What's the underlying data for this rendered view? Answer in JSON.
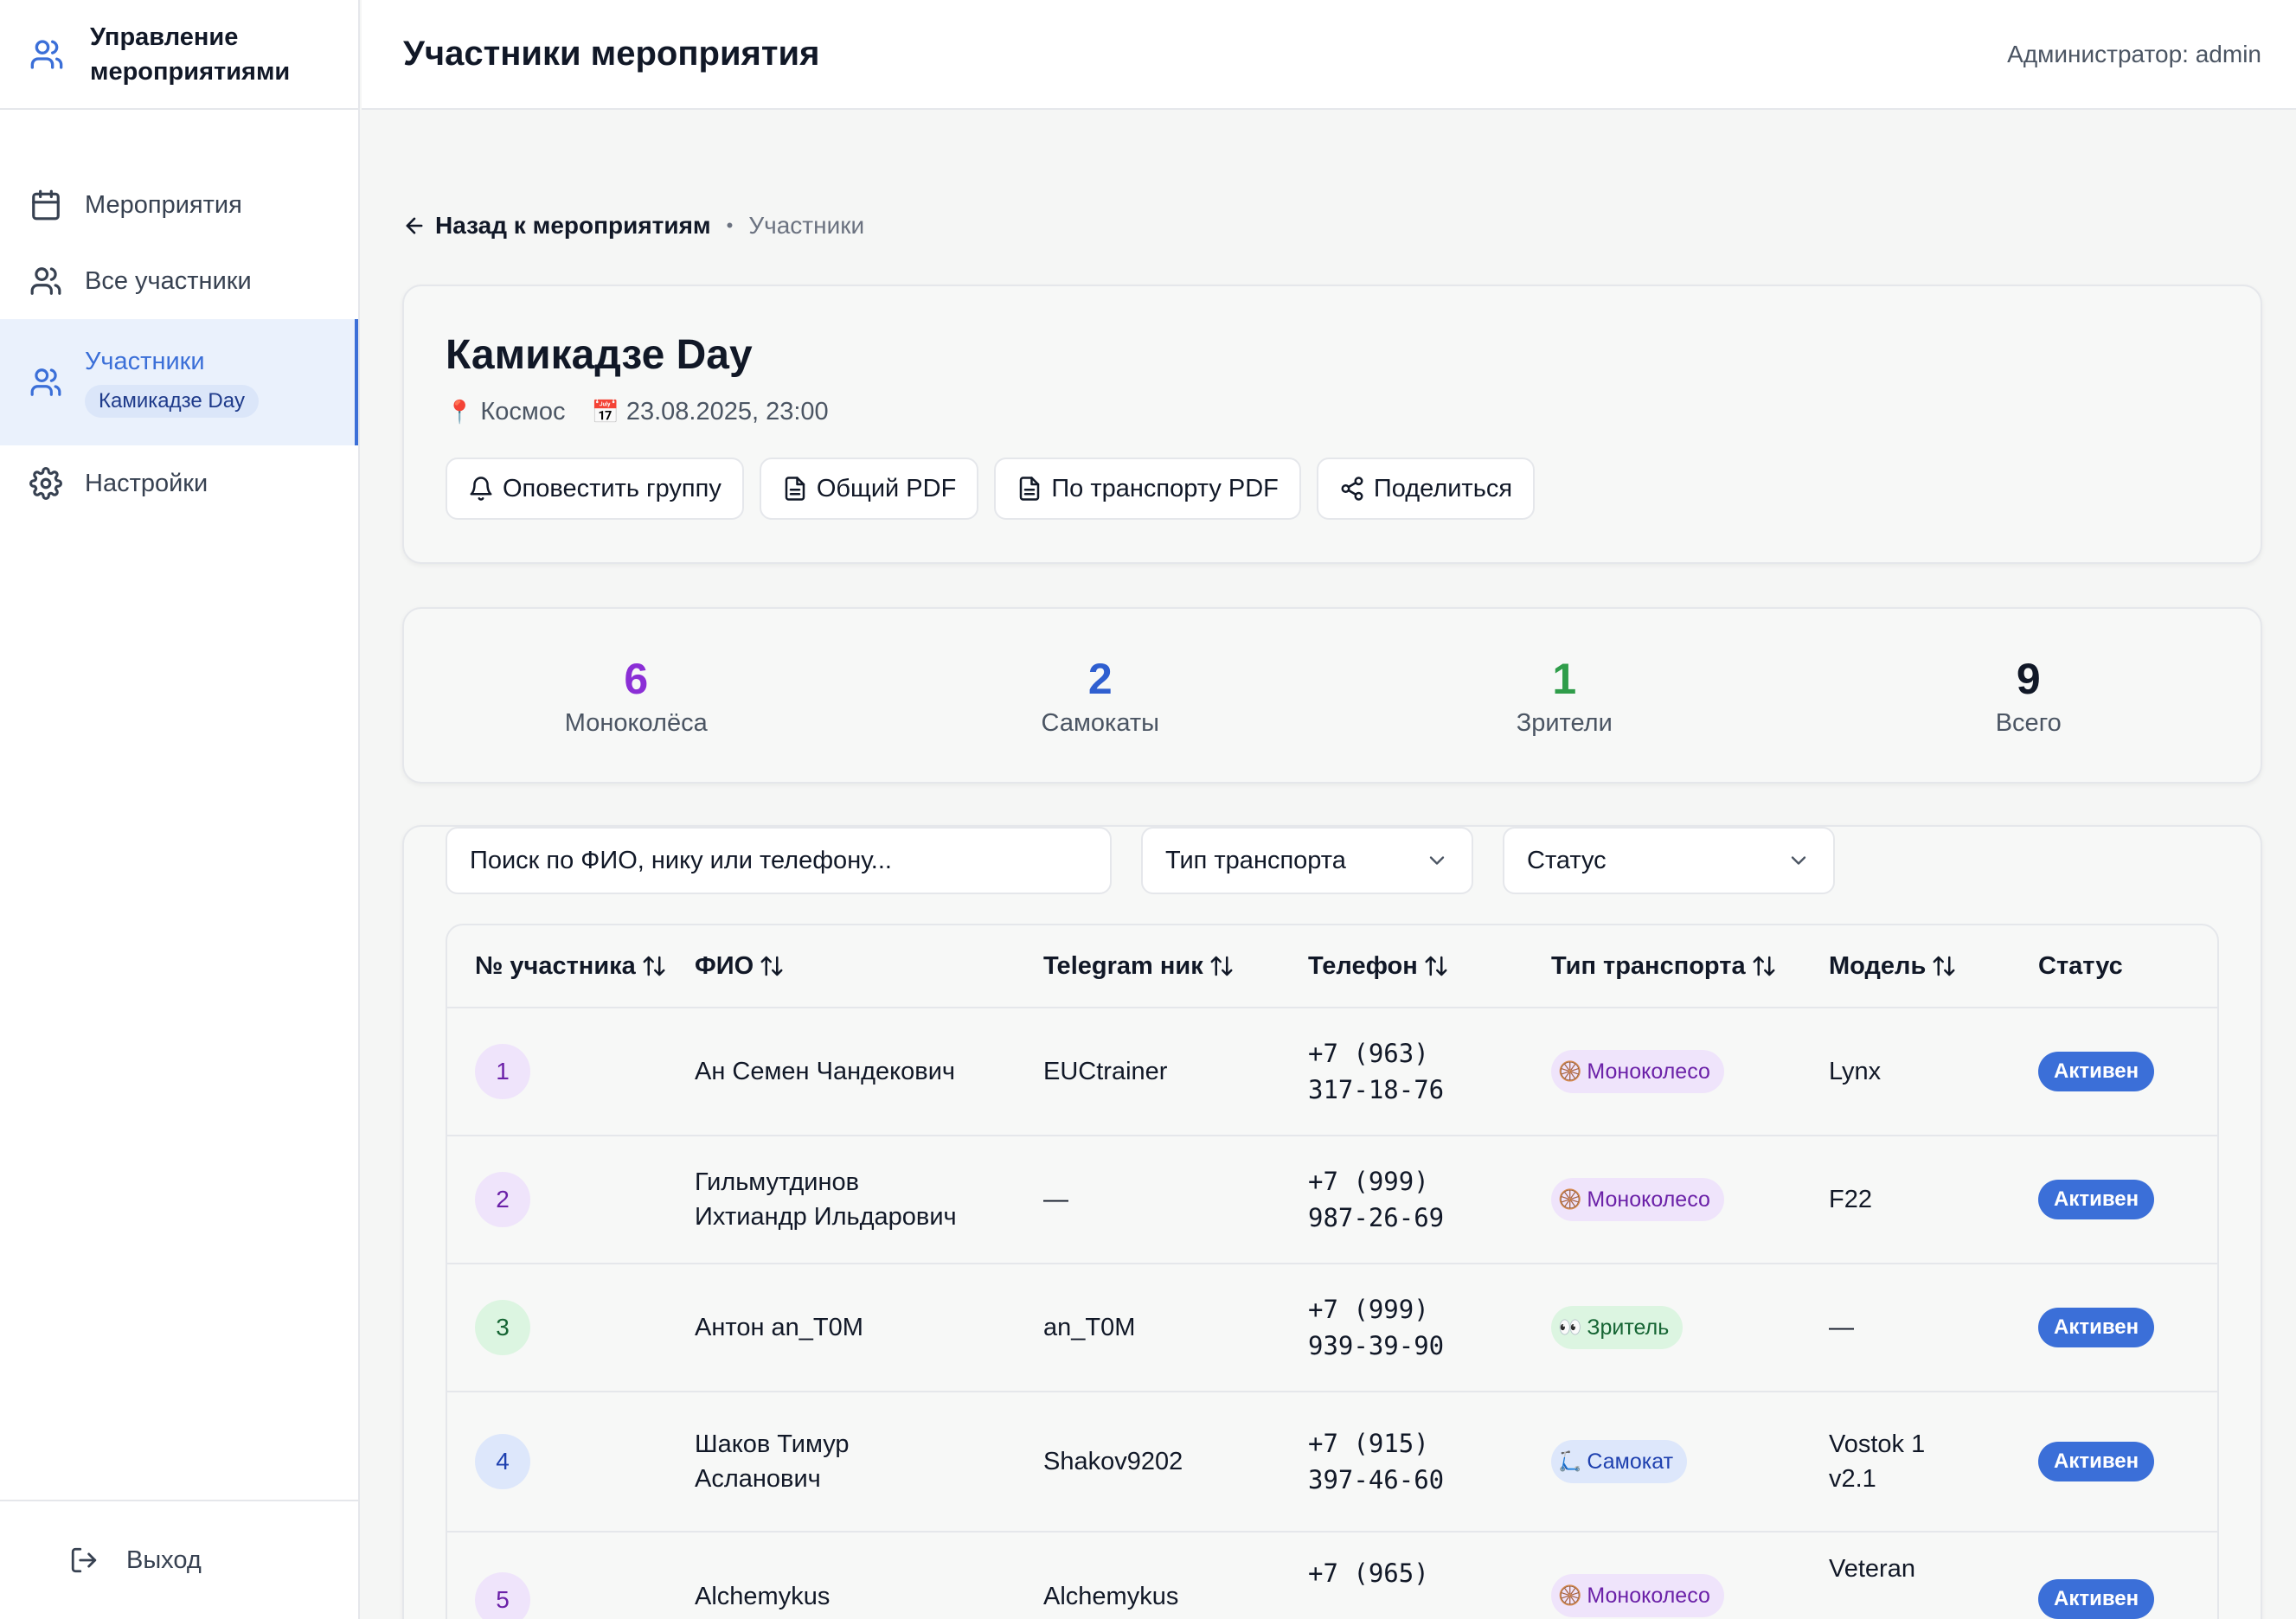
{
  "app": {
    "brand_title": "Управление мероприятиями",
    "page_title": "Участники мероприятия",
    "admin_label": "Администратор: admin"
  },
  "sidebar": {
    "items": [
      {
        "label": "Мероприятия",
        "icon": "calendar-icon"
      },
      {
        "label": "Все участники",
        "icon": "users-icon"
      },
      {
        "label": "Участники",
        "badge": "Камикадзе Day",
        "icon": "users-icon"
      },
      {
        "label": "Настройки",
        "icon": "gear-icon"
      }
    ],
    "logout": "Выход"
  },
  "breadcrumb": {
    "back": "Назад к мероприятиям",
    "current": "Участники"
  },
  "event": {
    "title": "Камикадзе Day",
    "location": "Космос",
    "datetime": "23.08.2025, 23:00",
    "actions": [
      "Оповестить группу",
      "Общий PDF",
      "По транспорту PDF",
      "Поделиться"
    ]
  },
  "stats": [
    {
      "value": "6",
      "label": "Моноколёса",
      "color": "#8b2fd6"
    },
    {
      "value": "2",
      "label": "Самокаты",
      "color": "#2f5fd0"
    },
    {
      "value": "1",
      "label": "Зрители",
      "color": "#2f9d4a"
    },
    {
      "value": "9",
      "label": "Всего",
      "color": "#111827"
    }
  ],
  "filters": {
    "search_placeholder": "Поиск по ФИО, нику или телефону...",
    "transport": "Тип транспорта",
    "status": "Статус"
  },
  "table": {
    "headers": [
      "№ участника",
      "ФИО",
      "Telegram ник",
      "Телефон",
      "Тип транспорта",
      "Модель",
      "Статус"
    ],
    "rows": [
      {
        "num": "1",
        "name1": "Ан Семен Чандекович",
        "name2": "",
        "tg": "EUCtrainer",
        "phone1": "+7 (963)",
        "phone2": "317-18-76",
        "type": "Моноколесо",
        "type_emoji": "🛞",
        "model1": "Lynx",
        "model2": "",
        "status": "Активен"
      },
      {
        "num": "2",
        "name1": "Гильмутдинов",
        "name2": "Ихтиандр Ильдарович",
        "tg": "—",
        "phone1": "+7 (999)",
        "phone2": "987-26-69",
        "type": "Моноколесо",
        "type_emoji": "🛞",
        "model1": "F22",
        "model2": "",
        "status": "Активен"
      },
      {
        "num": "3",
        "name1": "Антон an_T0M",
        "name2": "",
        "tg": "an_T0M",
        "phone1": "+7 (999)",
        "phone2": "939-39-90",
        "type": "Зритель",
        "type_emoji": "👀",
        "model1": "—",
        "model2": "",
        "status": "Активен"
      },
      {
        "num": "4",
        "name1": "Шаков Тимур",
        "name2": "Асланович",
        "tg": "Shakov9202",
        "phone1": "+7 (915)",
        "phone2": "397-46-60",
        "type": "Самокат",
        "type_emoji": "🛴",
        "model1": "Vostok 1",
        "model2": "v2.1",
        "status": "Активен"
      },
      {
        "num": "5",
        "name1": "Alchemykus",
        "name2": "",
        "tg": "Alchemykus",
        "phone1": "+7 (965)",
        "phone2": "",
        "type": "Моноколесо",
        "type_emoji": "🛞",
        "model1": "Veteran",
        "model2": "",
        "status": "Активен"
      }
    ]
  },
  "colors": {
    "accent": "#3b6fd8",
    "mono_bg": "#efe4fb",
    "mono_fg": "#6b21a8",
    "scooter_bg": "#dde7fb",
    "scooter_fg": "#1e40af",
    "viewer_bg": "#dcf5e1",
    "viewer_fg": "#166534"
  }
}
